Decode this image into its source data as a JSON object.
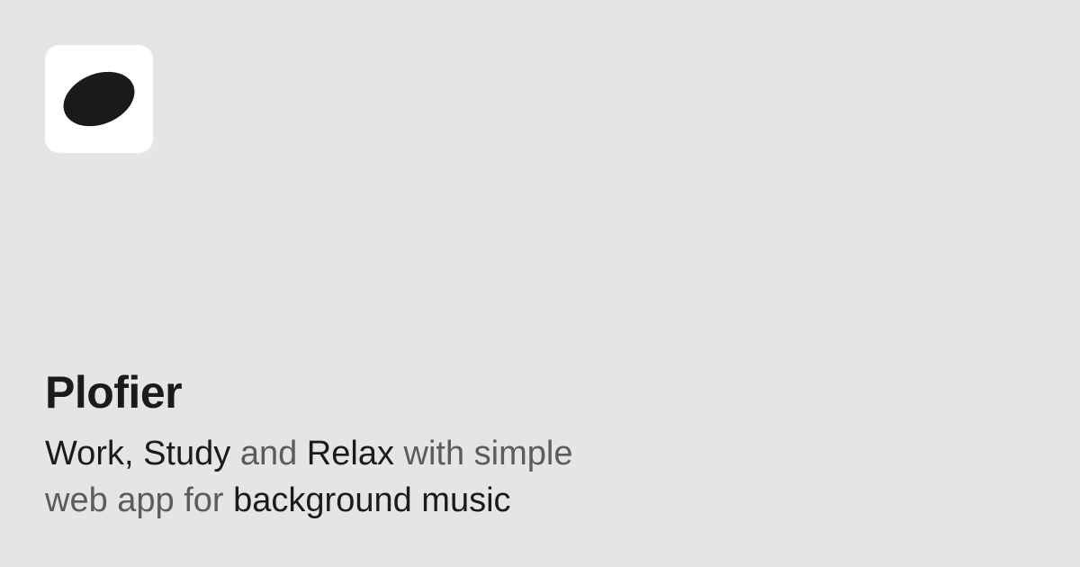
{
  "app": {
    "name": "Plofier",
    "logo_icon": "vinyl-ellipse-logo",
    "tile_color": "#ffffff",
    "mark_color": "#1a1a1a",
    "background_color": "#e5e5e5"
  },
  "tagline": {
    "line1": [
      {
        "text": "Work, Study",
        "tone": "strong"
      },
      {
        "text": " and ",
        "tone": "muted"
      },
      {
        "text": "Relax",
        "tone": "strong"
      },
      {
        "text": " with simple",
        "tone": "muted"
      }
    ],
    "line2": [
      {
        "text": "web app for ",
        "tone": "muted"
      },
      {
        "text": "background music",
        "tone": "strong"
      }
    ]
  }
}
